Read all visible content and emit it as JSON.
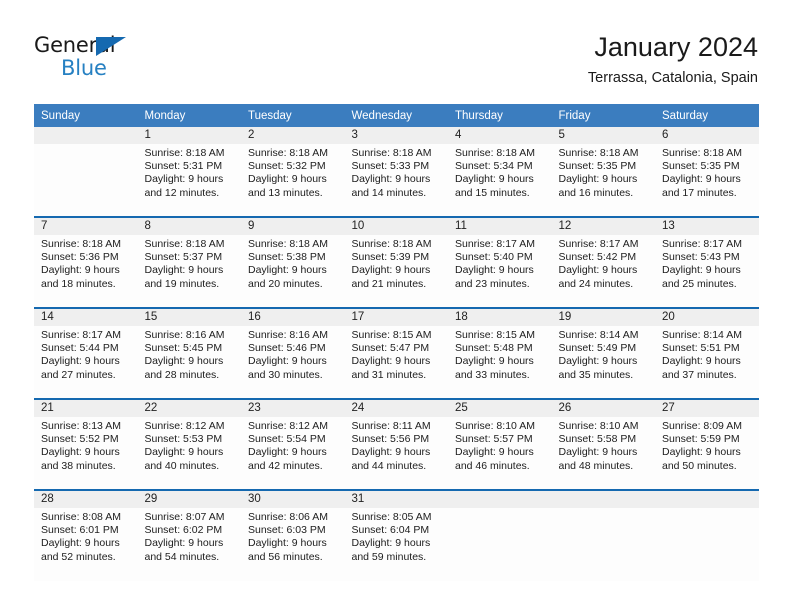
{
  "brand": {
    "name_part1": "General",
    "name_part2": "Blue",
    "logo_icon": "triangle-icon"
  },
  "header": {
    "title": "January 2024",
    "subtitle": "Terrassa, Catalonia, Spain"
  },
  "colors": {
    "header_blue": "#3b7dbf",
    "separator_blue": "#1569b0",
    "date_band_gray": "#efefef",
    "brand_blue": "#2680c2"
  },
  "weekday_headers": [
    "Sunday",
    "Monday",
    "Tuesday",
    "Wednesday",
    "Thursday",
    "Friday",
    "Saturday"
  ],
  "weeks": [
    {
      "days": [
        {
          "date": "",
          "sunrise": "",
          "sunset": "",
          "daylight_l1": "",
          "daylight_l2": "",
          "empty": true
        },
        {
          "date": "1",
          "sunrise": "Sunrise: 8:18 AM",
          "sunset": "Sunset: 5:31 PM",
          "daylight_l1": "Daylight: 9 hours",
          "daylight_l2": "and 12 minutes.",
          "empty": false
        },
        {
          "date": "2",
          "sunrise": "Sunrise: 8:18 AM",
          "sunset": "Sunset: 5:32 PM",
          "daylight_l1": "Daylight: 9 hours",
          "daylight_l2": "and 13 minutes.",
          "empty": false
        },
        {
          "date": "3",
          "sunrise": "Sunrise: 8:18 AM",
          "sunset": "Sunset: 5:33 PM",
          "daylight_l1": "Daylight: 9 hours",
          "daylight_l2": "and 14 minutes.",
          "empty": false
        },
        {
          "date": "4",
          "sunrise": "Sunrise: 8:18 AM",
          "sunset": "Sunset: 5:34 PM",
          "daylight_l1": "Daylight: 9 hours",
          "daylight_l2": "and 15 minutes.",
          "empty": false
        },
        {
          "date": "5",
          "sunrise": "Sunrise: 8:18 AM",
          "sunset": "Sunset: 5:35 PM",
          "daylight_l1": "Daylight: 9 hours",
          "daylight_l2": "and 16 minutes.",
          "empty": false
        },
        {
          "date": "6",
          "sunrise": "Sunrise: 8:18 AM",
          "sunset": "Sunset: 5:35 PM",
          "daylight_l1": "Daylight: 9 hours",
          "daylight_l2": "and 17 minutes.",
          "empty": false
        }
      ]
    },
    {
      "days": [
        {
          "date": "7",
          "sunrise": "Sunrise: 8:18 AM",
          "sunset": "Sunset: 5:36 PM",
          "daylight_l1": "Daylight: 9 hours",
          "daylight_l2": "and 18 minutes.",
          "empty": false
        },
        {
          "date": "8",
          "sunrise": "Sunrise: 8:18 AM",
          "sunset": "Sunset: 5:37 PM",
          "daylight_l1": "Daylight: 9 hours",
          "daylight_l2": "and 19 minutes.",
          "empty": false
        },
        {
          "date": "9",
          "sunrise": "Sunrise: 8:18 AM",
          "sunset": "Sunset: 5:38 PM",
          "daylight_l1": "Daylight: 9 hours",
          "daylight_l2": "and 20 minutes.",
          "empty": false
        },
        {
          "date": "10",
          "sunrise": "Sunrise: 8:18 AM",
          "sunset": "Sunset: 5:39 PM",
          "daylight_l1": "Daylight: 9 hours",
          "daylight_l2": "and 21 minutes.",
          "empty": false
        },
        {
          "date": "11",
          "sunrise": "Sunrise: 8:17 AM",
          "sunset": "Sunset: 5:40 PM",
          "daylight_l1": "Daylight: 9 hours",
          "daylight_l2": "and 23 minutes.",
          "empty": false
        },
        {
          "date": "12",
          "sunrise": "Sunrise: 8:17 AM",
          "sunset": "Sunset: 5:42 PM",
          "daylight_l1": "Daylight: 9 hours",
          "daylight_l2": "and 24 minutes.",
          "empty": false
        },
        {
          "date": "13",
          "sunrise": "Sunrise: 8:17 AM",
          "sunset": "Sunset: 5:43 PM",
          "daylight_l1": "Daylight: 9 hours",
          "daylight_l2": "and 25 minutes.",
          "empty": false
        }
      ]
    },
    {
      "days": [
        {
          "date": "14",
          "sunrise": "Sunrise: 8:17 AM",
          "sunset": "Sunset: 5:44 PM",
          "daylight_l1": "Daylight: 9 hours",
          "daylight_l2": "and 27 minutes.",
          "empty": false
        },
        {
          "date": "15",
          "sunrise": "Sunrise: 8:16 AM",
          "sunset": "Sunset: 5:45 PM",
          "daylight_l1": "Daylight: 9 hours",
          "daylight_l2": "and 28 minutes.",
          "empty": false
        },
        {
          "date": "16",
          "sunrise": "Sunrise: 8:16 AM",
          "sunset": "Sunset: 5:46 PM",
          "daylight_l1": "Daylight: 9 hours",
          "daylight_l2": "and 30 minutes.",
          "empty": false
        },
        {
          "date": "17",
          "sunrise": "Sunrise: 8:15 AM",
          "sunset": "Sunset: 5:47 PM",
          "daylight_l1": "Daylight: 9 hours",
          "daylight_l2": "and 31 minutes.",
          "empty": false
        },
        {
          "date": "18",
          "sunrise": "Sunrise: 8:15 AM",
          "sunset": "Sunset: 5:48 PM",
          "daylight_l1": "Daylight: 9 hours",
          "daylight_l2": "and 33 minutes.",
          "empty": false
        },
        {
          "date": "19",
          "sunrise": "Sunrise: 8:14 AM",
          "sunset": "Sunset: 5:49 PM",
          "daylight_l1": "Daylight: 9 hours",
          "daylight_l2": "and 35 minutes.",
          "empty": false
        },
        {
          "date": "20",
          "sunrise": "Sunrise: 8:14 AM",
          "sunset": "Sunset: 5:51 PM",
          "daylight_l1": "Daylight: 9 hours",
          "daylight_l2": "and 37 minutes.",
          "empty": false
        }
      ]
    },
    {
      "days": [
        {
          "date": "21",
          "sunrise": "Sunrise: 8:13 AM",
          "sunset": "Sunset: 5:52 PM",
          "daylight_l1": "Daylight: 9 hours",
          "daylight_l2": "and 38 minutes.",
          "empty": false
        },
        {
          "date": "22",
          "sunrise": "Sunrise: 8:12 AM",
          "sunset": "Sunset: 5:53 PM",
          "daylight_l1": "Daylight: 9 hours",
          "daylight_l2": "and 40 minutes.",
          "empty": false
        },
        {
          "date": "23",
          "sunrise": "Sunrise: 8:12 AM",
          "sunset": "Sunset: 5:54 PM",
          "daylight_l1": "Daylight: 9 hours",
          "daylight_l2": "and 42 minutes.",
          "empty": false
        },
        {
          "date": "24",
          "sunrise": "Sunrise: 8:11 AM",
          "sunset": "Sunset: 5:56 PM",
          "daylight_l1": "Daylight: 9 hours",
          "daylight_l2": "and 44 minutes.",
          "empty": false
        },
        {
          "date": "25",
          "sunrise": "Sunrise: 8:10 AM",
          "sunset": "Sunset: 5:57 PM",
          "daylight_l1": "Daylight: 9 hours",
          "daylight_l2": "and 46 minutes.",
          "empty": false
        },
        {
          "date": "26",
          "sunrise": "Sunrise: 8:10 AM",
          "sunset": "Sunset: 5:58 PM",
          "daylight_l1": "Daylight: 9 hours",
          "daylight_l2": "and 48 minutes.",
          "empty": false
        },
        {
          "date": "27",
          "sunrise": "Sunrise: 8:09 AM",
          "sunset": "Sunset: 5:59 PM",
          "daylight_l1": "Daylight: 9 hours",
          "daylight_l2": "and 50 minutes.",
          "empty": false
        }
      ]
    },
    {
      "days": [
        {
          "date": "28",
          "sunrise": "Sunrise: 8:08 AM",
          "sunset": "Sunset: 6:01 PM",
          "daylight_l1": "Daylight: 9 hours",
          "daylight_l2": "and 52 minutes.",
          "empty": false
        },
        {
          "date": "29",
          "sunrise": "Sunrise: 8:07 AM",
          "sunset": "Sunset: 6:02 PM",
          "daylight_l1": "Daylight: 9 hours",
          "daylight_l2": "and 54 minutes.",
          "empty": false
        },
        {
          "date": "30",
          "sunrise": "Sunrise: 8:06 AM",
          "sunset": "Sunset: 6:03 PM",
          "daylight_l1": "Daylight: 9 hours",
          "daylight_l2": "and 56 minutes.",
          "empty": false
        },
        {
          "date": "31",
          "sunrise": "Sunrise: 8:05 AM",
          "sunset": "Sunset: 6:04 PM",
          "daylight_l1": "Daylight: 9 hours",
          "daylight_l2": "and 59 minutes.",
          "empty": false
        },
        {
          "date": "",
          "sunrise": "",
          "sunset": "",
          "daylight_l1": "",
          "daylight_l2": "",
          "empty": true
        },
        {
          "date": "",
          "sunrise": "",
          "sunset": "",
          "daylight_l1": "",
          "daylight_l2": "",
          "empty": true
        },
        {
          "date": "",
          "sunrise": "",
          "sunset": "",
          "daylight_l1": "",
          "daylight_l2": "",
          "empty": true
        }
      ]
    }
  ]
}
